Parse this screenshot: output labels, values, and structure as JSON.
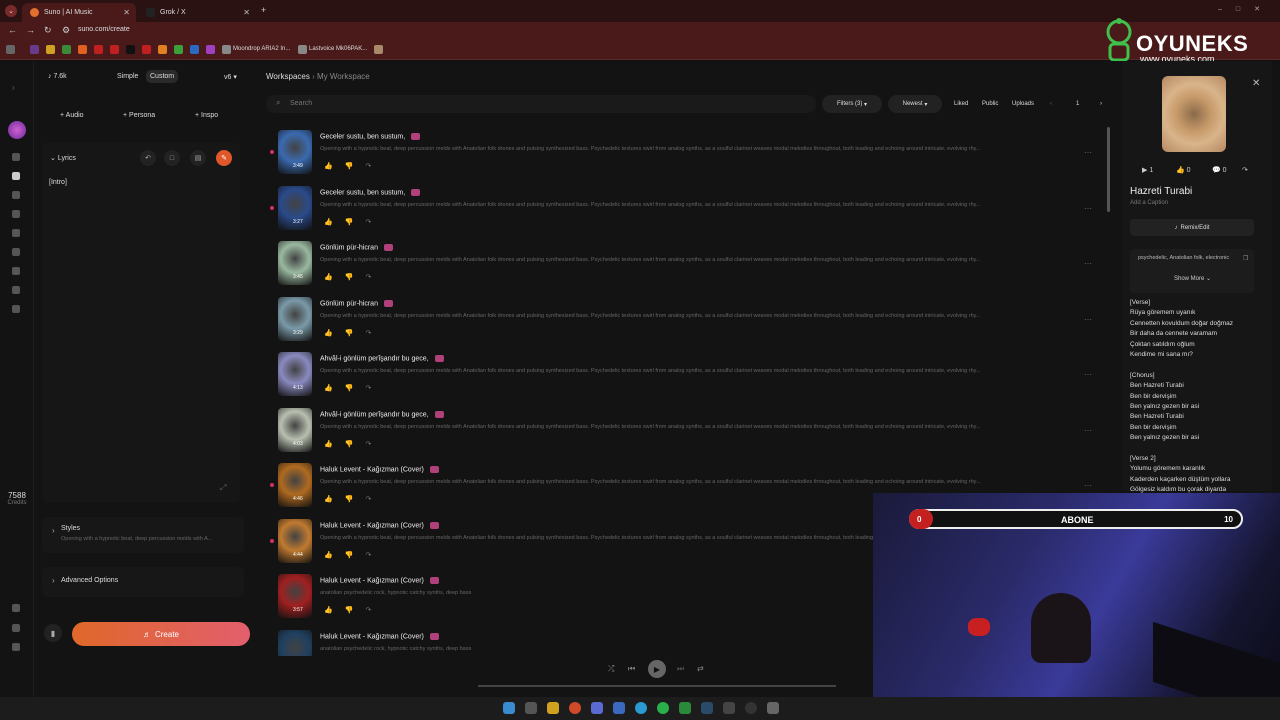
{
  "browser": {
    "tabs": [
      {
        "label": "Suno | AI Music",
        "active": true
      },
      {
        "label": "Grok / X",
        "active": false
      }
    ],
    "url": "suno.com/create",
    "bookmarks": [
      "Moondrop ARIA2 In...",
      "Lastvoice Mk06PAK..."
    ]
  },
  "overlay": {
    "brand": "OYUNEKS",
    "site": "www.oyuneks.com"
  },
  "sidebar": {
    "credits_value": "7588",
    "credits_label": "Credits"
  },
  "left": {
    "version_count": "7.6k",
    "mode_simple": "Simple",
    "mode_custom": "Custom",
    "model": "v6",
    "add_audio": "Audio",
    "add_persona": "Persona",
    "add_inspo": "Inspo",
    "lyrics_label": "Lyrics",
    "lyrics_text": "[Intro]",
    "styles_label": "Styles",
    "styles_text": "Opening with a hypnotic beat, deep percussion melds with A...",
    "advanced_label": "Advanced Options",
    "create_label": "Create"
  },
  "main": {
    "breadcrumb_root": "Workspaces",
    "breadcrumb_current": "My Workspace",
    "search_placeholder": "Search",
    "filters": "Filters (3)",
    "sort": "Newest",
    "liked": "Liked",
    "public": "Public",
    "uploads": "Uploads",
    "page": "1",
    "rows": [
      {
        "title": "Geceler sustu, ben sustum,",
        "duration": "3:49",
        "desc": "Opening with a hypnotic beat, deep percussion melds with Anatolian folk drones and pulsing synthesized bass. Psychedelic textures swirl from analog synths, as a soulful clarinet weaves modal melodies throughout, both leading and echoing around intricate, evolving rhy...",
        "color": "#3b6ab0"
      },
      {
        "title": "Geceler sustu, ben sustum,",
        "duration": "3:27",
        "desc": "Opening with a hypnotic beat, deep percussion melds with Anatolian folk drones and pulsing synthesized bass. Psychedelic textures swirl from analog synths, as a soulful clarinet weaves modal melodies throughout, both leading and echoing around intricate, evolving rhy...",
        "color": "#2a4a8a"
      },
      {
        "title": "Gönlüm pür-hicran",
        "duration": "3:45",
        "desc": "Opening with a hypnotic beat, deep percussion melds with Anatolian folk drones and pulsing synthesized bass. Psychedelic textures swirl from analog synths, as a soulful clarinet weaves modal melodies throughout, both leading and echoing around intricate, evolving rhy...",
        "color": "#9ab8a0"
      },
      {
        "title": "Gönlüm pür-hicran",
        "duration": "3:29",
        "desc": "Opening with a hypnotic beat, deep percussion melds with Anatolian folk drones and pulsing synthesized bass. Psychedelic textures swirl from analog synths, as a soulful clarinet weaves modal melodies throughout, both leading and echoing around intricate, evolving rhy...",
        "color": "#7a9aa8"
      },
      {
        "title": "Ahvâl-i gönlüm perîşandır bu gece,",
        "duration": "4:13",
        "desc": "Opening with a hypnotic beat, deep percussion melds with Anatolian folk drones and pulsing synthesized bass. Psychedelic textures swirl from analog synths, as a soulful clarinet weaves modal melodies throughout, both leading and echoing around intricate, evolving rhy...",
        "color": "#8a8ac0"
      },
      {
        "title": "Ahvâl-i gönlüm perîşandır bu gece,",
        "duration": "4:03",
        "desc": "Opening with a hypnotic beat, deep percussion melds with Anatolian folk drones and pulsing synthesized bass. Psychedelic textures swirl from analog synths, as a soulful clarinet weaves modal melodies throughout, both leading and echoing around intricate, evolving rhy...",
        "color": "#b8c0b0"
      },
      {
        "title": "Haluk Levent - Kağızman (Cover)",
        "duration": "4:46",
        "desc": "Opening with a hypnotic beat, deep percussion melds with Anatolian folk drones and pulsing synthesized bass. Psychedelic textures swirl from analog synths, as a soulful clarinet weaves modal melodies throughout, both leading and echoing around intricate, evolving rhy...",
        "color": "#b06a20"
      },
      {
        "title": "Haluk Levent - Kağızman (Cover)",
        "duration": "4:44",
        "desc": "Opening with a hypnotic beat, deep percussion melds with Anatolian folk drones and pulsing synthesized bass. Psychedelic textures swirl from analog synths, as a soulful clarinet weaves modal melodies throughout, both leading and echoing around intricate, evolving rhy...",
        "color": "#c07a30"
      },
      {
        "title": "Haluk Levent - Kağızman (Cover)",
        "duration": "3:57",
        "desc": "anatolian psychedelic rock, hypnotic catchy synths, deep bass",
        "color": "#a02020"
      },
      {
        "title": "Haluk Levent - Kağızman (Cover)",
        "duration": "",
        "desc": "anatolian psychedelic rock, hypnotic catchy synths, deep bass",
        "color": "#204060"
      }
    ]
  },
  "right": {
    "plays": "1",
    "likes": "0",
    "comments": "0",
    "title": "Hazreti Turabi",
    "caption": "Add a Caption",
    "remix": "Remix/Edit",
    "tags": "psychedelic, Anatolian folk, electronic",
    "show_more": "Show More",
    "lyrics": [
      "[Verse]",
      "Rüya göremem uyanık",
      "Cennetten kovuldum doğar doğmaz",
      "Bir daha da cennete varamam",
      "Çoktan satıldım oğlum",
      "Kendime mi sana mı?",
      "",
      "[Chorus]",
      "Ben Hazreti Turabi",
      "Ben bir dervişim",
      "Ben yalnız gezen bir asi",
      "Ben Hazreti Turabi",
      "Ben bir dervişim",
      "Ben yalnız gezen bir asi",
      "",
      "[Verse 2]",
      "Yolumu göremem karanlık",
      "Kaderden kaçarken düştüm yollara",
      "Gölgesiz kaldım bu çorak diyarda"
    ]
  },
  "webcam": {
    "sub_left": "0",
    "sub_label": "ABONE",
    "sub_right": "10",
    "sub_fraction": 0.0
  }
}
